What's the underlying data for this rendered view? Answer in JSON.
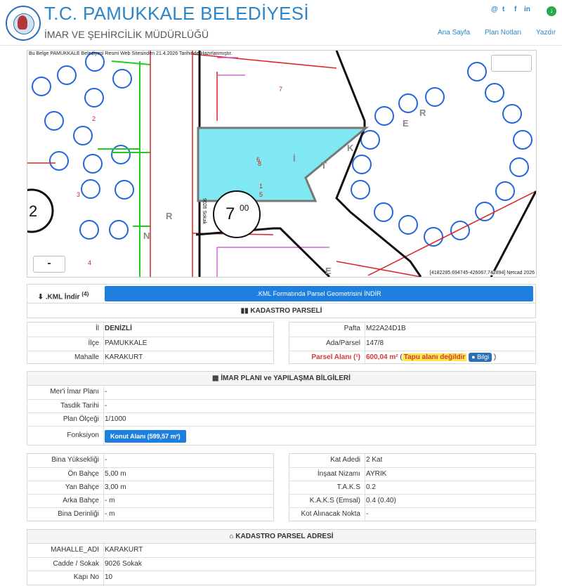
{
  "header": {
    "title": "T.C. PAMUKKALE BELEDİYESİ",
    "subtitle": "İMAR VE ŞEHİRCİLİK MÜDÜRLÜĞÜ",
    "nav": [
      "Ana Sayfa",
      "Plan Notları",
      "Yazdır"
    ],
    "social": [
      "@",
      "t",
      "f",
      "in"
    ]
  },
  "map": {
    "note": "Bu Belge PAMUKKALE Belediyesi Resmi Web Sitesinden 21.4.2026 Tarihinde Hazırlanmıştır.",
    "coords": "[4182285.694745-426067.742894] Netcad 2026",
    "zoom_minus": "-",
    "labels": {
      "parcel_number": "7",
      "parcel_sup": "00",
      "street": "9026 Sokak",
      "letters": [
        "R",
        "E",
        "K",
        "T",
        "İ",
        "R",
        "N",
        "E"
      ],
      "numbers": [
        "2",
        "3",
        "4",
        "6",
        "7",
        "8",
        "1",
        "5",
        "2"
      ]
    }
  },
  "kml": {
    "label": ".KML İndir",
    "label_sup": "(4)",
    "button": ".KML Formatında Parsel Geometrisini İNDİR"
  },
  "kadastro": {
    "heading": "KADASTRO PARSELİ",
    "left": [
      {
        "label": "İl",
        "value": "DENİZLİ"
      },
      {
        "label": "İlçe",
        "value": "PAMUKKALE"
      },
      {
        "label": "Mahalle",
        "value": "KARAKURT"
      }
    ],
    "right": [
      {
        "label": "Pafta",
        "value": "M22A24D1B"
      },
      {
        "label": "Ada/Parsel",
        "value": "147/8"
      }
    ],
    "parsel_label": "Parsel Alanı (¹)",
    "parsel_value": "600,04 m²",
    "parsel_note_open": "(",
    "parsel_note": "Tapu alanı değildir",
    "parsel_bilgi": "Bilgi",
    "parsel_note_close": ")"
  },
  "imar": {
    "heading": "İMAR PLANI ve YAPILAŞMA BİLGİLERİ",
    "rows": [
      {
        "label": "Mer'i İmar Planı",
        "value": "-"
      },
      {
        "label": "Tasdik Tarihi",
        "value": "-"
      },
      {
        "label": "Plan Ölçeği",
        "value": "1/1000"
      }
    ],
    "fonksiyon_label": "Fonksiyon",
    "fonksiyon_value": "Konut Alanı (599,57 m²)"
  },
  "yapi": {
    "left": [
      {
        "label": "Bina Yüksekliği",
        "value": "-"
      },
      {
        "label": "Ön Bahçe",
        "value": "5,00 m"
      },
      {
        "label": "Yan Bahçe",
        "value": "3,00 m"
      },
      {
        "label": "Arka Bahçe",
        "value": "- m"
      },
      {
        "label": "Bina Derinliği",
        "value": "- m"
      }
    ],
    "right": [
      {
        "label": "Kat Adedi",
        "value": "2 Kat"
      },
      {
        "label": "İnşaat Nizamı",
        "value": "AYRIK"
      },
      {
        "label": "T.A.K.S",
        "value": "0.2"
      },
      {
        "label": "K.A.K.S (Emsal)",
        "value": "0.4 (0.40)"
      },
      {
        "label": "Kot Alınacak Nokta",
        "value": "-"
      }
    ]
  },
  "adres": {
    "heading": "KADASTRO PARSEL ADRESİ",
    "rows": [
      {
        "label": "MAHALLE_ADI",
        "value": "KARAKURT"
      },
      {
        "label": "Cadde / Sokak",
        "value": "9026 Sokak"
      },
      {
        "label": "Kapı No",
        "value": "10"
      }
    ]
  },
  "colors": {
    "brand": "#2a86c8",
    "button": "#1f7fdf",
    "parcel_fill": "#7fe8f2",
    "warning": "#d23b3b"
  }
}
